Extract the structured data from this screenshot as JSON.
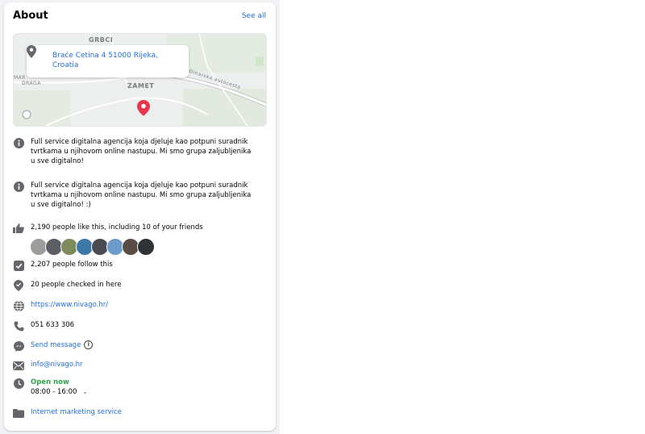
{
  "header": {
    "title": "About",
    "see_all": "See all"
  },
  "map": {
    "labels": {
      "north": "GRBCI",
      "west1": "MAR",
      "west2": "DRAGA",
      "center": "ZAMET",
      "road": "Dinarska autocesta"
    },
    "address": "Braće Cetina 4 51000 Rijeka, Croatia"
  },
  "about": {
    "description1": "Full service digitalna agencija koja djeluje kao potpuni suradnik tvrtkama u njihovom online nastupu. Mi smo grupa zaljubljenika u sve digitalno!",
    "description2": "Full service digitalna agencija koja djeluje kao potpuni suradnik tvrtkama u njihovom online nastupu. Mi smo grupa zaljubljenika u sve digitalno! :)",
    "likes": "2,190 people like this, including 10 of your friends",
    "follows": "2,207 people follow this",
    "checkins": "20 people checked in here",
    "website": "https://www.nivago.hr/",
    "phone": "051 633 306",
    "message": "Send message",
    "email": "info@nivago.hr",
    "open_status": "Open now",
    "hours": "08:00 - 16:00",
    "category": "Internet marketing service"
  },
  "colors": {
    "link": "#216fdb",
    "open": "#31a24c",
    "pin": "#e8374c"
  }
}
